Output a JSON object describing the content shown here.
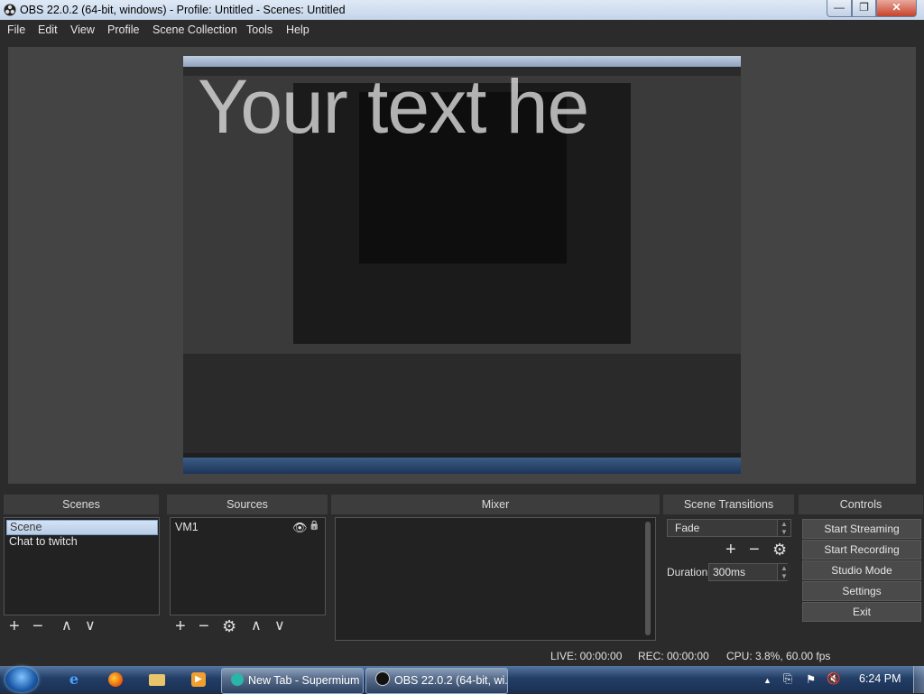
{
  "window": {
    "title": "OBS 22.0.2 (64-bit, windows) - Profile: Untitled - Scenes: Untitled",
    "min_glyph": "—",
    "max_glyph": "❐",
    "close_glyph": "✕"
  },
  "menu": [
    "File",
    "Edit",
    "View",
    "Profile",
    "Scene Collection",
    "Tools",
    "Help"
  ],
  "preview": {
    "overlay_text": "Your text he"
  },
  "docks": {
    "scenes": {
      "header": "Scenes",
      "items": [
        "Scene",
        "Chat to twitch"
      ],
      "selected": "Scene"
    },
    "sources": {
      "header": "Sources",
      "items": [
        "VM1"
      ]
    },
    "mixer": {
      "header": "Mixer"
    },
    "transitions": {
      "header": "Scene Transitions",
      "transition": "Fade",
      "duration_label": "Duration",
      "duration_value": "300ms"
    },
    "controls": {
      "header": "Controls",
      "buttons": [
        "Start Streaming",
        "Start Recording",
        "Studio Mode",
        "Settings",
        "Exit"
      ]
    }
  },
  "status": {
    "live": "LIVE: 00:00:00",
    "rec": "REC: 00:00:00",
    "cpu": "CPU: 3.8%, 60.00 fps"
  },
  "taskbar": {
    "tasks": [
      "New Tab - Supermium",
      "OBS 22.0.2 (64-bit, wi..."
    ],
    "clock": "6:24 PM"
  },
  "icons": {
    "add": "+",
    "remove": "−",
    "up": "∧",
    "down": "∨",
    "gear": "⚙",
    "eye": "👁",
    "lock": "🔒"
  }
}
